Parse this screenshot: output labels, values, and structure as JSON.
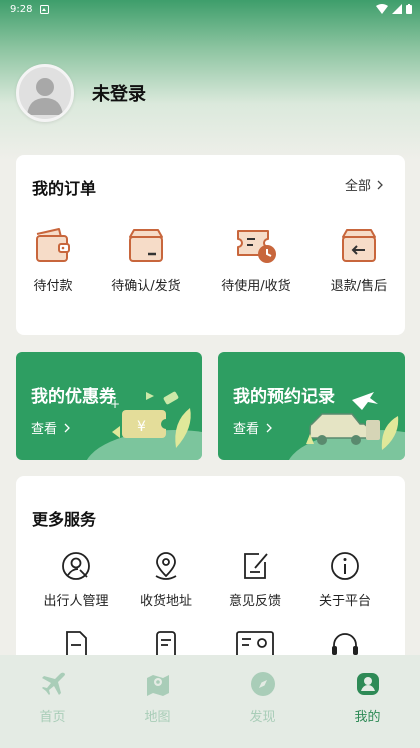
{
  "status_bar": {
    "time": "9:28"
  },
  "profile": {
    "username": "未登录"
  },
  "orders": {
    "title": "我的订单",
    "all_label": "全部",
    "items": [
      {
        "label": "待付款",
        "icon": "wallet-icon"
      },
      {
        "label": "待确认/发货",
        "icon": "box-icon"
      },
      {
        "label": "待使用/收货",
        "icon": "ticket-clock-icon"
      },
      {
        "label": "退款/售后",
        "icon": "return-box-icon"
      }
    ]
  },
  "promos": [
    {
      "title": "我的优惠券",
      "link": "查看"
    },
    {
      "title": "我的预约记录",
      "link": "查看"
    }
  ],
  "services": {
    "title": "更多服务",
    "items": [
      {
        "label": "出行人管理",
        "icon": "traveler-icon"
      },
      {
        "label": "收货地址",
        "icon": "location-icon"
      },
      {
        "label": "意见反馈",
        "icon": "feedback-icon"
      },
      {
        "label": "关于平台",
        "icon": "info-icon"
      }
    ]
  },
  "tabbar": [
    {
      "label": "首页",
      "icon": "plane-icon",
      "active": false
    },
    {
      "label": "地图",
      "icon": "map-icon",
      "active": false
    },
    {
      "label": "发现",
      "icon": "compass-icon",
      "active": false
    },
    {
      "label": "我的",
      "icon": "user-icon",
      "active": true
    }
  ],
  "colors": {
    "brand": "#2e9e62",
    "orders_icon": "#c8663c",
    "tab_inactive": "#a9cdb8",
    "tab_active": "#2e8a56"
  }
}
